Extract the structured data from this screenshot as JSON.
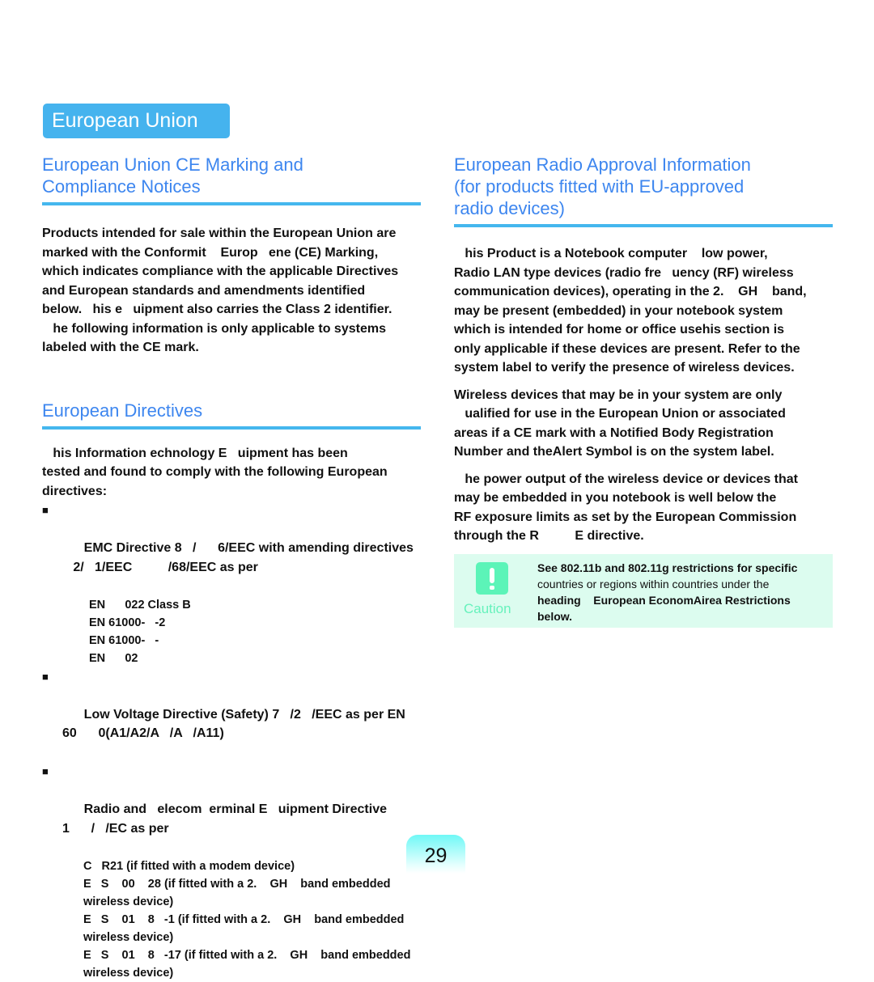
{
  "header": {
    "tab_title": "European Union"
  },
  "left": {
    "ce_section": {
      "title_line1": "European Union CE Marking and",
      "title_line2": "Compliance Notices",
      "paragraph": "Products intended for sale within the European Union are\nmarked with the Conformit    Europ   ene (CE) Marking,\nwhich indicates compliance with the applicable Directives\nand European standards and amendments identified\nbelow.   his e   uipment also carries the Class 2 identifier.\n   he following information is only applicable to systems\nlabeled with the CE mark."
    },
    "directives_section": {
      "title": "European Directives",
      "intro": "   his Information echnology E   uipment has been\ntested and found to comply with the following European\ndirectives:",
      "bullet_marker": "■",
      "bullets": [
        {
          "text": "EMC Directive 8   /      6/EEC with amending directives\n   2/   1/EEC          /68/EEC as per",
          "subitems": [
            "EN      022 Class B",
            "EN 61000-   -2",
            "EN 61000-   -",
            "EN      02"
          ]
        },
        {
          "text": "Low Voltage Directive (Safety) 7   /2   /EEC as per EN\n60      0(A1/A2/A   /A   /A11)",
          "subitems": []
        },
        {
          "text": "Radio and   elecom  erminal E   uipment Directive\n1      /   /EC as per",
          "subitems": [
            "C   R21 (if fitted with a modem device)",
            "E   S    00    28 (if fitted with a 2.    GH    band embedded\nwireless device)",
            "E   S    01    8   -1 (if fitted with a 2.    GH    band embedded\nwireless device)",
            "E   S    01    8   -17 (if fitted with a 2.    GH    band embedded\nwireless device)"
          ]
        }
      ]
    }
  },
  "right": {
    "radio_section": {
      "title_line1": "European Radio Approval Information",
      "title_line2": "(for products fitted with EU-approved",
      "title_line3": "radio devices)",
      "paragraph1": "   his Product is a Notebook computer    low power,\nRadio LAN type devices (radio fre   uency (RF) wireless\ncommunication devices), operating in the 2.    GH    band,\nmay be present (embedded) in your notebook system\nwhich is intended for home or office usehis section is\nonly applicable if these devices are present. Refer to the\nsystem label to verify the presence of wireless devices.",
      "paragraph2": "Wireless devices that may be in your system are only\n   ualified for use in the European Union or associated\nareas if a CE mark with a Notified Body Registration\nNumber and theAlert Symbol is on the system label.",
      "paragraph3": "   he power output of the wireless device or devices that\nmay be embedded in you notebook is well below the\nRF exposure limits as set by the European Commission\nthrough the R          E directive."
    },
    "caution": {
      "label": "Caution",
      "icon": "exclamation-icon",
      "line1": "See 802.11b and 802.11g restrictions for specific",
      "line2": "countries or regions within countries under the",
      "line3_heading": "heading",
      "line3_rest": "    European EconomAirea Restrictions",
      "line4": "below."
    }
  },
  "footer": {
    "page_number": "29"
  },
  "colors": {
    "tab_bg": "#45b3ee",
    "section_title": "#3d86ef",
    "rule": "#45b7ee",
    "caution_bg": "#dcfcef",
    "caution_accent": "#5cf4b8"
  }
}
